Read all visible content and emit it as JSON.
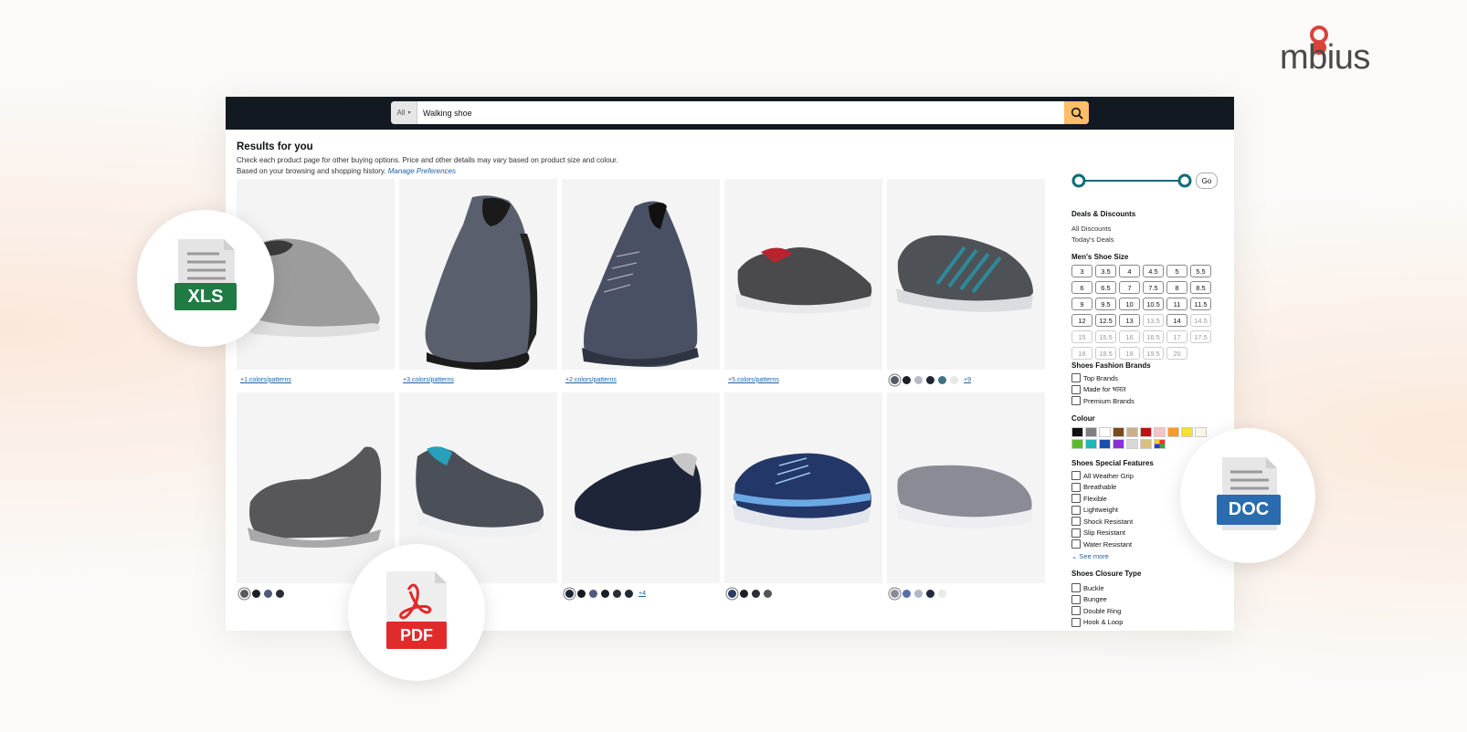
{
  "brand": {
    "logo_text": "mbius",
    "accent": "#d9433a"
  },
  "search": {
    "category": "All",
    "query": "Walking shoe"
  },
  "results": {
    "title": "Results for you",
    "subtitle": "Check each product page for other buying options. Price and other details may vary based on product size and colour.",
    "history_text": "Based on your browsing and shopping history.",
    "manage_link": "Manage Preferences"
  },
  "products": [
    {
      "colors_text": "+1 colors/patterns"
    },
    {
      "colors_text": "+3 colors/patterns"
    },
    {
      "colors_text": "+2 colors/patterns"
    },
    {
      "colors_text": "+5 colors/patterns"
    },
    {
      "more": "+9"
    },
    {},
    {},
    {
      "more": "+4"
    },
    {},
    {}
  ],
  "sidebar": {
    "go_label": "Go",
    "deals_title": "Deals & Discounts",
    "deals": [
      "All Discounts",
      "Today's Deals"
    ],
    "size_title": "Men's Shoe Size",
    "sizes": [
      "3",
      "3.5",
      "4",
      "4.5",
      "5",
      "5.5",
      "6",
      "6.5",
      "7",
      "7.5",
      "8",
      "8.5",
      "9",
      "9.5",
      "10",
      "10.5",
      "11",
      "11.5",
      "12",
      "12.5",
      "13",
      "13.5",
      "14",
      "14.5",
      "15",
      "15.5",
      "16",
      "16.5",
      "17",
      "17.5",
      "18",
      "18.5",
      "19",
      "19.5",
      "20"
    ],
    "brands_title": "Shoes Fashion Brands",
    "brands": [
      "Top Brands",
      "Made for भारत",
      "Premium Brands"
    ],
    "colour_title": "Colour",
    "features_title": "Shoes Special Features",
    "features": [
      "All Weather Grip",
      "Breathable",
      "Flexible",
      "Lightweight",
      "Shock Resistant",
      "Slip Resistant",
      "Water Resistant"
    ],
    "see_more": "See more",
    "closure_title": "Shoes Closure Type",
    "closures": [
      "Buckle",
      "Bungee",
      "Double Ring",
      "Hook & Loop"
    ]
  },
  "badges": {
    "xls": "XLS",
    "pdf": "PDF",
    "doc": "DOC"
  },
  "colors": {
    "topbar": "#131921",
    "search_button": "#febd69",
    "link": "#2162a1",
    "slider": "#0f6b7a",
    "xls_green": "#1f7a43",
    "pdf_red": "#e12a2a",
    "doc_blue": "#2a6cad"
  }
}
